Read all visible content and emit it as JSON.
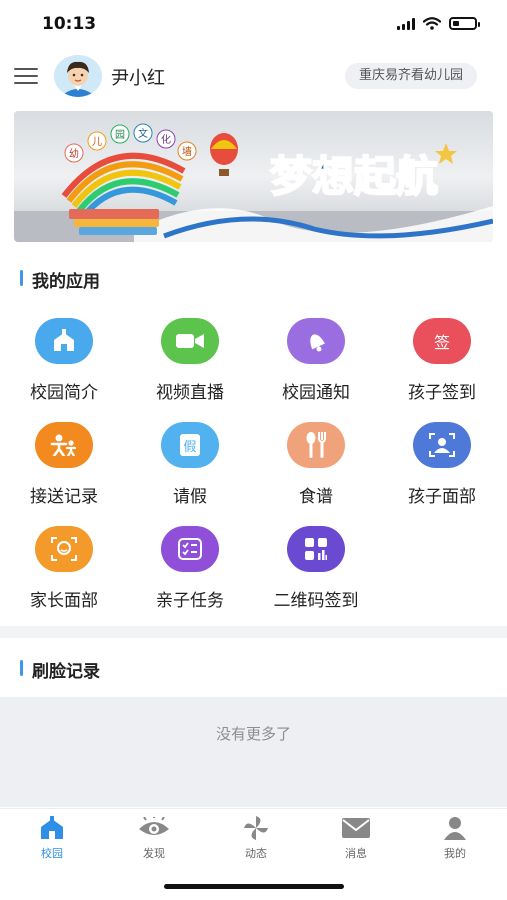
{
  "status_bar": {
    "time": "10:13"
  },
  "header": {
    "user_name": "尹小红",
    "school_name": "重庆易齐看幼儿园"
  },
  "banner": {
    "slogan": "梦想起航",
    "wall_text": "幼儿园文化墙"
  },
  "sections": {
    "my_apps": "我的应用",
    "face_records": "刷脸记录"
  },
  "apps": [
    {
      "label": "校园简介",
      "icon": "school-icon",
      "color": "#4aa8ec"
    },
    {
      "label": "视频直播",
      "icon": "video-camera-icon",
      "color": "#5cc34c"
    },
    {
      "label": "校园通知",
      "icon": "bell-icon",
      "color": "#9a6ee0"
    },
    {
      "label": "孩子签到",
      "icon": "sign-icon",
      "color": "#e9505b",
      "glyph": "签"
    },
    {
      "label": "接送记录",
      "icon": "pickup-people-icon",
      "color": "#f28a1f"
    },
    {
      "label": "请假",
      "icon": "leave-icon",
      "color": "#52b2ef",
      "glyph": "假"
    },
    {
      "label": "食谱",
      "icon": "fork-spoon-icon",
      "color": "#f0a37a"
    },
    {
      "label": "孩子面部",
      "icon": "child-face-icon",
      "color": "#4f79d9"
    },
    {
      "label": "家长面部",
      "icon": "parent-face-icon",
      "color": "#f39a2b"
    },
    {
      "label": "亲子任务",
      "icon": "task-list-icon",
      "color": "#8f4fd8"
    },
    {
      "label": "二维码签到",
      "icon": "qr-code-icon",
      "color": "#6b4ad2"
    }
  ],
  "empty_state": "没有更多了",
  "tabs": [
    {
      "label": "校园",
      "icon": "home-icon",
      "active": true
    },
    {
      "label": "发现",
      "icon": "eye-icon",
      "active": false
    },
    {
      "label": "动态",
      "icon": "pinwheel-icon",
      "active": false
    },
    {
      "label": "消息",
      "icon": "mail-icon",
      "active": false
    },
    {
      "label": "我的",
      "icon": "person-icon",
      "active": false
    }
  ],
  "colors": {
    "accent": "#2f8fe6",
    "section_marker": "#3f97ea"
  }
}
